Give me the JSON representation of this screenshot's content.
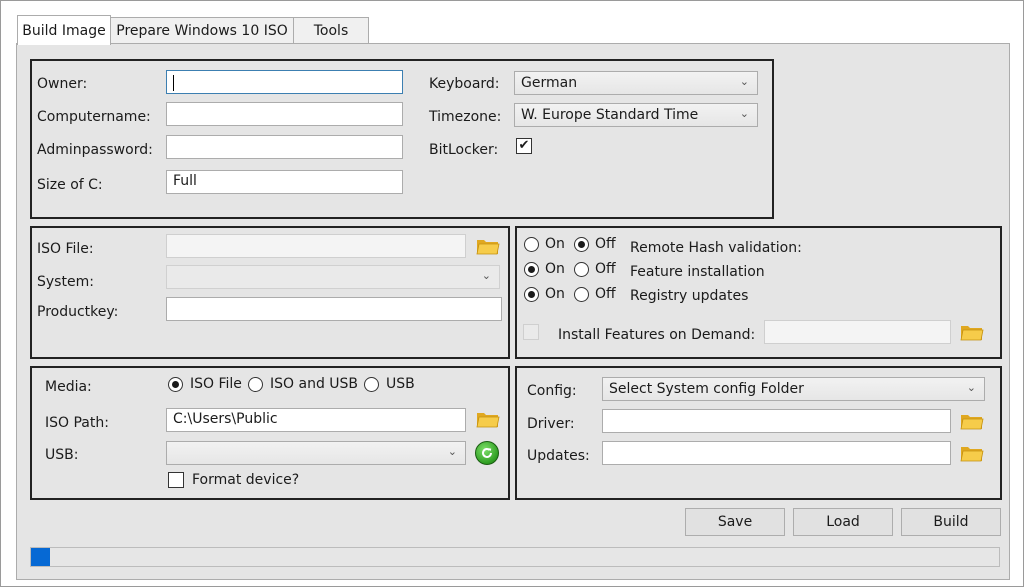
{
  "tabs": [
    {
      "label": "Build Image",
      "active": true
    },
    {
      "label": "Prepare Windows 10 ISO",
      "active": false
    },
    {
      "label": "Tools",
      "active": false
    }
  ],
  "settings": {
    "owner_label": "Owner:",
    "owner_value": "",
    "computername_label": "Computername:",
    "computername_value": "",
    "adminpassword_label": "Adminpassword:",
    "adminpassword_value": "",
    "sizec_label": "Size of C:",
    "sizec_value": "Full",
    "keyboard_label": "Keyboard:",
    "keyboard_value": "German",
    "timezone_label": "Timezone:",
    "timezone_value": "W. Europe Standard Time",
    "bitlocker_label": "BitLocker:",
    "bitlocker_checked": true,
    "bitlocker_mark": "✔"
  },
  "iso": {
    "isofile_label": "ISO File:",
    "isofile_value": "",
    "system_label": "System:",
    "system_value": "",
    "productkey_label": "Productkey:",
    "productkey_value": ""
  },
  "options": {
    "on_label": "On",
    "off_label": "Off",
    "rows": [
      {
        "label": "Remote Hash validation:",
        "selected": "off"
      },
      {
        "label": "Feature installation",
        "selected": "on"
      },
      {
        "label": "Registry updates",
        "selected": "on"
      }
    ],
    "fod_label": "Install Features on Demand:",
    "fod_checked": false,
    "fod_value": ""
  },
  "media": {
    "media_label": "Media:",
    "radio_iso": "ISO File",
    "radio_iso_usb": "ISO and USB",
    "radio_usb": "USB",
    "selected": "iso",
    "isopath_label": "ISO Path:",
    "isopath_value": "C:\\Users\\Public",
    "usb_label": "USB:",
    "usb_value": "",
    "format_label": "Format device?",
    "format_checked": false
  },
  "config": {
    "config_label": "Config:",
    "config_value": "Select System config Folder",
    "driver_label": "Driver:",
    "driver_value": "",
    "updates_label": "Updates:",
    "updates_value": ""
  },
  "actions": {
    "save_label": "Save",
    "load_label": "Load",
    "build_label": "Build"
  },
  "progress": {
    "fraction": 0.02
  },
  "icons": {
    "folder": "folder-open-icon",
    "refresh": "refresh-icon",
    "chevron": "chevron-down-icon"
  },
  "colors": {
    "progress_fill": "#0669d4",
    "folder": "#f2c23a",
    "refresh": "#2f9e22"
  }
}
